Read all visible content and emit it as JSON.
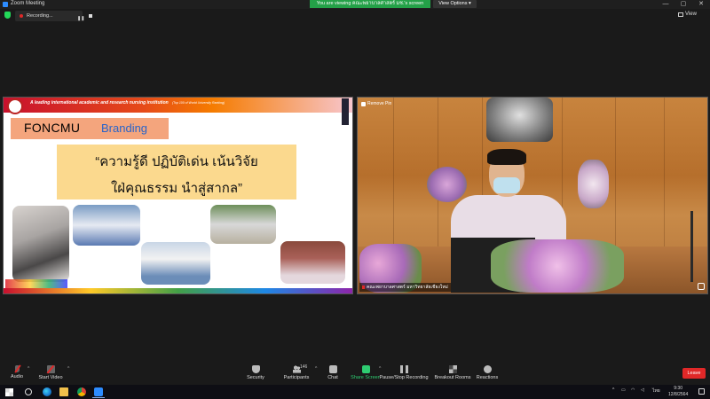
{
  "window": {
    "title": "Zoom Meeting",
    "banner": "You are viewing คณะพยาบาลศาสตร์ มช.'s screen",
    "view_options_label": "View Options",
    "controls": {
      "minimize": "—",
      "maximize": "▢",
      "close": "✕"
    }
  },
  "top_bar": {
    "recording_label": "Recording...",
    "pause_icon": "❚❚",
    "view_label": "View"
  },
  "shared_slide": {
    "tagline": "A leading international academic and research nursing institution",
    "tagline_note": "(Top 100 of World University Ranking)",
    "brand_name": "FONCMU",
    "brand_sub": "Branding",
    "motto_line1": "“ความรู้ดี ปฏิบัติเด่น เน้นวิจัย",
    "motto_line2": "ใฝ่คุณธรรม นำสู่สากล”"
  },
  "camera_tile": {
    "remove_pin_label": "Remove Pin",
    "participant_name": "คณะพยาบาลศาสตร์ มหาวิทยาลัยเชียงใหม่"
  },
  "toolbar": {
    "audio": "Audio",
    "start_video": "Start Video",
    "security": "Security",
    "participants": "Participants",
    "participants_count": "146",
    "chat": "Chat",
    "share_screen": "Share Screen",
    "pause_stop_recording": "Pause/Stop Recording",
    "breakout_rooms": "Breakout Rooms",
    "reactions": "Reactions",
    "leave": "Leave",
    "caret": "^"
  },
  "taskbar": {
    "tray_caret": "^",
    "language": "ไทย",
    "time": "9:30",
    "date": "12/8/2564"
  },
  "colors": {
    "share_green": "#2ecc71",
    "leave_red": "#e02828",
    "banner_green": "#24a148",
    "zoom_blue": "#2d8cff"
  }
}
